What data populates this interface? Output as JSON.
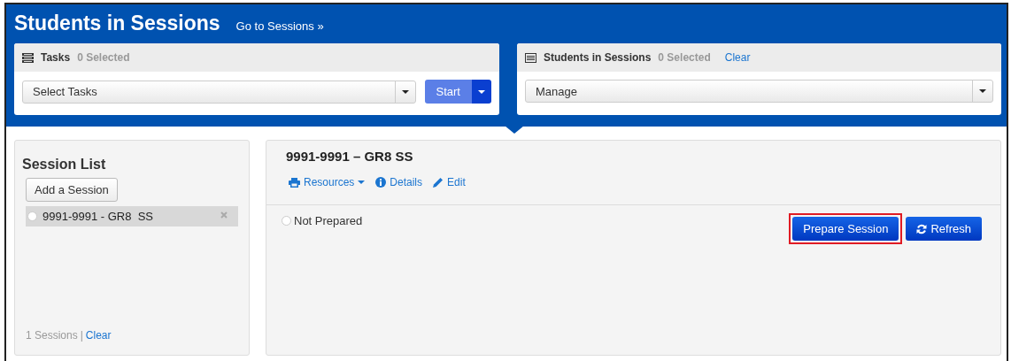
{
  "header": {
    "title": "Students in Sessions",
    "link": "Go to Sessions »"
  },
  "tasks_card": {
    "title": "Tasks",
    "count": "0 Selected",
    "select": {
      "value": "Select Tasks"
    },
    "start_button": "Start"
  },
  "students_card": {
    "title": "Students in Sessions",
    "count": "0 Selected",
    "clear_link": "Clear",
    "select": {
      "value": "Manage"
    }
  },
  "session_list": {
    "title": "Session List",
    "add_button": "Add a Session",
    "items": [
      {
        "label": "9991-9991 - GR8  SS",
        "selected": true,
        "checked": false
      }
    ],
    "footer": {
      "count": "1 Sessions",
      "separator": "|",
      "clear_link": "Clear"
    }
  },
  "session_detail": {
    "title": "9991-9991 – GR8 SS",
    "actions": [
      {
        "kind": "resources",
        "label": "Resources"
      },
      {
        "kind": "details",
        "label": "Details"
      },
      {
        "kind": "edit",
        "label": "Edit"
      }
    ],
    "status": {
      "label": "Not Prepared",
      "checked": false
    },
    "buttons": [
      {
        "kind": "prepare",
        "label": "Prepare Session",
        "highlighted": true
      },
      {
        "kind": "refresh",
        "label": "Refresh",
        "highlighted": false
      }
    ]
  }
}
